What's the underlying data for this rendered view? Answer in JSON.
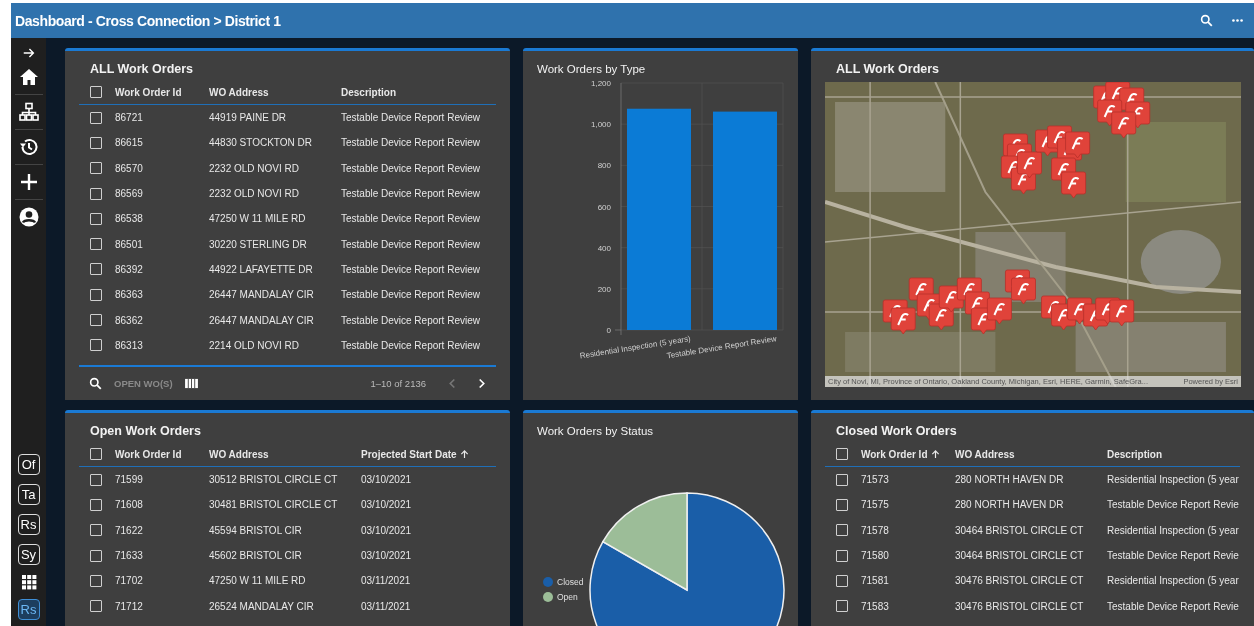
{
  "header": {
    "title": "Dashboard - Cross Connection > District 1"
  },
  "sidebar": {
    "nav_items": [
      {
        "kind": "expand"
      },
      {
        "kind": "home"
      },
      {
        "kind": "hierarchy"
      },
      {
        "kind": "history"
      },
      {
        "kind": "add"
      },
      {
        "kind": "account"
      }
    ],
    "apps": [
      {
        "kind": "badge",
        "label": "Of",
        "selected": false
      },
      {
        "kind": "badge",
        "label": "Ta",
        "selected": false
      },
      {
        "kind": "badge",
        "label": "Rs",
        "selected": false
      },
      {
        "kind": "badge",
        "label": "Sy",
        "selected": false
      },
      {
        "kind": "grid",
        "selected": false
      },
      {
        "kind": "badge",
        "label": "Rs",
        "selected": true
      }
    ]
  },
  "all_work_orders": {
    "title": "ALL Work Orders",
    "select_all_checked": false,
    "columns": [
      {
        "label": "Work Order Id",
        "sorted": false
      },
      {
        "label": "WO Address",
        "sorted": false
      },
      {
        "label": "Description",
        "sorted": false
      }
    ],
    "rows": [
      {
        "checked": false,
        "cells": [
          "86721",
          "44919 PAINE DR",
          "Testable Device Report Review"
        ]
      },
      {
        "checked": false,
        "cells": [
          "86615",
          "44830 STOCKTON DR",
          "Testable Device Report Review"
        ]
      },
      {
        "checked": false,
        "cells": [
          "86570",
          "2232 OLD NOVI RD",
          "Testable Device Report Review"
        ]
      },
      {
        "checked": false,
        "cells": [
          "86569",
          "2232 OLD NOVI RD",
          "Testable Device Report Review"
        ]
      },
      {
        "checked": false,
        "cells": [
          "86538",
          "47250 W 11 MILE RD",
          "Testable Device Report Review"
        ]
      },
      {
        "checked": false,
        "cells": [
          "86501",
          "30220 STERLING DR",
          "Testable Device Report Review"
        ]
      },
      {
        "checked": false,
        "cells": [
          "86392",
          "44922 LAFAYETTE DR",
          "Testable Device Report Review"
        ]
      },
      {
        "checked": false,
        "cells": [
          "86363",
          "26447 MANDALAY CIR",
          "Testable Device Report Review"
        ]
      },
      {
        "checked": false,
        "cells": [
          "86362",
          "26447 MANDALAY CIR",
          "Testable Device Report Review"
        ]
      },
      {
        "checked": false,
        "cells": [
          "86313",
          "2214 OLD NOVI RD",
          "Testable Device Report Review"
        ]
      }
    ],
    "footer": {
      "action": {
        "label": "OPEN WO(S)",
        "disabled": true
      },
      "page_range": "1–10 of 2136",
      "prev_disabled": true,
      "next_disabled": false
    }
  },
  "type_chart": {
    "chart_data": {
      "type": "bar",
      "title": "Work Orders by Type",
      "categories": [
        "Residential Inspection (5 years)",
        "Testable Device Report Review"
      ],
      "series": [
        {
          "color": "#0b7bd6",
          "values": [
            1075,
            1061
          ]
        }
      ],
      "grid": true,
      "ylim": [
        0,
        1200
      ],
      "yticks": [
        {
          "value": 0,
          "label": "0"
        },
        {
          "value": 200,
          "label": "200"
        },
        {
          "value": 400,
          "label": "400"
        },
        {
          "value": 600,
          "label": "600"
        },
        {
          "value": 800,
          "label": "800"
        },
        {
          "value": 1000,
          "label": "1,000"
        },
        {
          "value": 1200,
          "label": "1,200"
        }
      ]
    }
  },
  "map": {
    "title": "ALL Work Orders",
    "attribution": "City of Novi, MI, Province of Ontario, Oakland County, Michigan, Esri, HERE, Garmin, SafeGra...",
    "powered_by": "Powered by Esri"
  },
  "open_work_orders": {
    "title": "Open Work Orders",
    "select_all_checked": false,
    "columns": [
      {
        "label": "Work Order Id",
        "sorted": false
      },
      {
        "label": "WO Address",
        "sorted": false
      },
      {
        "label": "Projected Start Date",
        "sorted": true
      }
    ],
    "rows": [
      {
        "checked": false,
        "cells": [
          "71599",
          "30512 BRISTOL CIRCLE CT",
          "03/10/2021"
        ]
      },
      {
        "checked": false,
        "cells": [
          "71608",
          "30481 BRISTOL CIRCLE CT",
          "03/10/2021"
        ]
      },
      {
        "checked": false,
        "cells": [
          "71622",
          "45594 BRISTOL CIR",
          "03/10/2021"
        ]
      },
      {
        "checked": false,
        "cells": [
          "71633",
          "45602 BRISTOL CIR",
          "03/10/2021"
        ]
      },
      {
        "checked": false,
        "cells": [
          "71702",
          "47250 W 11 MILE RD",
          "03/11/2021"
        ]
      },
      {
        "checked": false,
        "cells": [
          "71712",
          "26524 MANDALAY CIR",
          "03/11/2021"
        ]
      }
    ]
  },
  "status_chart": {
    "chart_data": {
      "type": "pie",
      "title": "Work Orders by Status",
      "categories": [
        "Closed",
        "Open"
      ],
      "series": [
        {
          "values": [
            0.833,
            0.167
          ]
        }
      ],
      "colors": [
        "#1a5ea8",
        "#9cbd98"
      ],
      "legend": "left"
    }
  },
  "closed_work_orders": {
    "title": "Closed Work Orders",
    "select_all_checked": false,
    "columns": [
      {
        "label": "Work Order Id",
        "sorted": true
      },
      {
        "label": "WO Address",
        "sorted": false
      },
      {
        "label": "Description",
        "sorted": false
      }
    ],
    "rows": [
      {
        "checked": false,
        "cells": [
          "71573",
          "280 NORTH HAVEN DR",
          "Residential Inspection (5 year"
        ]
      },
      {
        "checked": false,
        "cells": [
          "71575",
          "280 NORTH HAVEN DR",
          "Testable Device Report Revie"
        ]
      },
      {
        "checked": false,
        "cells": [
          "71578",
          "30464 BRISTOL CIRCLE CT",
          "Residential Inspection (5 year"
        ]
      },
      {
        "checked": false,
        "cells": [
          "71580",
          "30464 BRISTOL CIRCLE CT",
          "Testable Device Report Revie"
        ]
      },
      {
        "checked": false,
        "cells": [
          "71581",
          "30476 BRISTOL CIRCLE CT",
          "Residential Inspection (5 year"
        ]
      },
      {
        "checked": false,
        "cells": [
          "71583",
          "30476 BRISTOL CIRCLE CT",
          "Testable Device Report Revie"
        ]
      }
    ]
  }
}
